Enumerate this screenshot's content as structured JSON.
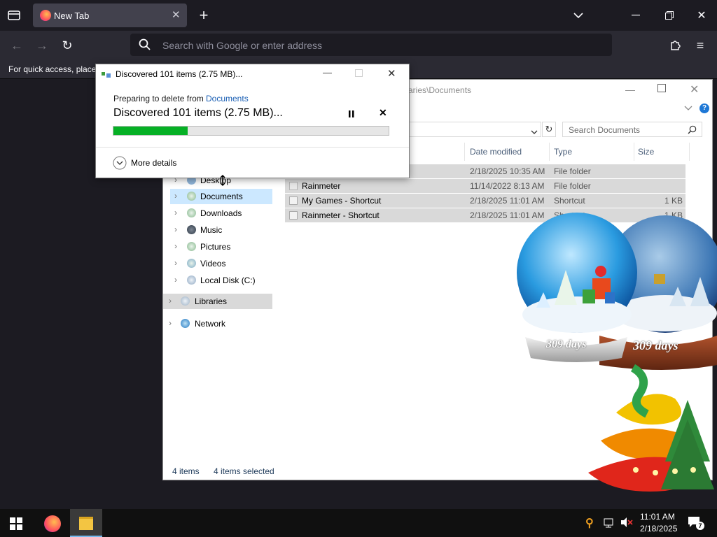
{
  "browser": {
    "tab_title": "New Tab",
    "url_placeholder": "Search with Google or enter address",
    "bookmarks_hint": "For quick access, place"
  },
  "dialog": {
    "title": "Discovered 101 items (2.75 MB)...",
    "preparing_prefix": "Preparing to delete from",
    "preparing_target": "Documents",
    "status": "Discovered 101 items (2.75 MB)...",
    "progress_fraction": 0.27,
    "more_details": "More details"
  },
  "explorer": {
    "path_fragment": "raries\\Documents",
    "search_placeholder": "Search Documents",
    "columns": [
      "Date modified",
      "Type",
      "Size"
    ],
    "files": [
      {
        "name": "",
        "date": "2/18/2025 10:35 AM",
        "type": "File folder",
        "size": ""
      },
      {
        "name": "Rainmeter",
        "date": "11/14/2022 8:13 AM",
        "type": "File folder",
        "size": ""
      },
      {
        "name": "My Games - Shortcut",
        "date": "2/18/2025 11:01 AM",
        "type": "Shortcut",
        "size": "1 KB"
      },
      {
        "name": "Rainmeter - Shortcut",
        "date": "2/18/2025 11:01 AM",
        "type": "Shortcut",
        "size": "1 KB"
      }
    ],
    "nav": [
      {
        "label": "Desktop"
      },
      {
        "label": "Documents"
      },
      {
        "label": "Downloads"
      },
      {
        "label": "Music"
      },
      {
        "label": "Pictures"
      },
      {
        "label": "Videos"
      },
      {
        "label": "Local Disk (C:)"
      },
      {
        "label": "Libraries"
      },
      {
        "label": "Network"
      }
    ],
    "status_items": "4 items",
    "status_selected": "4 items selected"
  },
  "desktop_widget": {
    "days_label_1": "309 days",
    "days_label_2": "309 days"
  },
  "taskbar": {
    "time": "11:01 AM",
    "date": "2/18/2025",
    "notification_count": "7"
  }
}
